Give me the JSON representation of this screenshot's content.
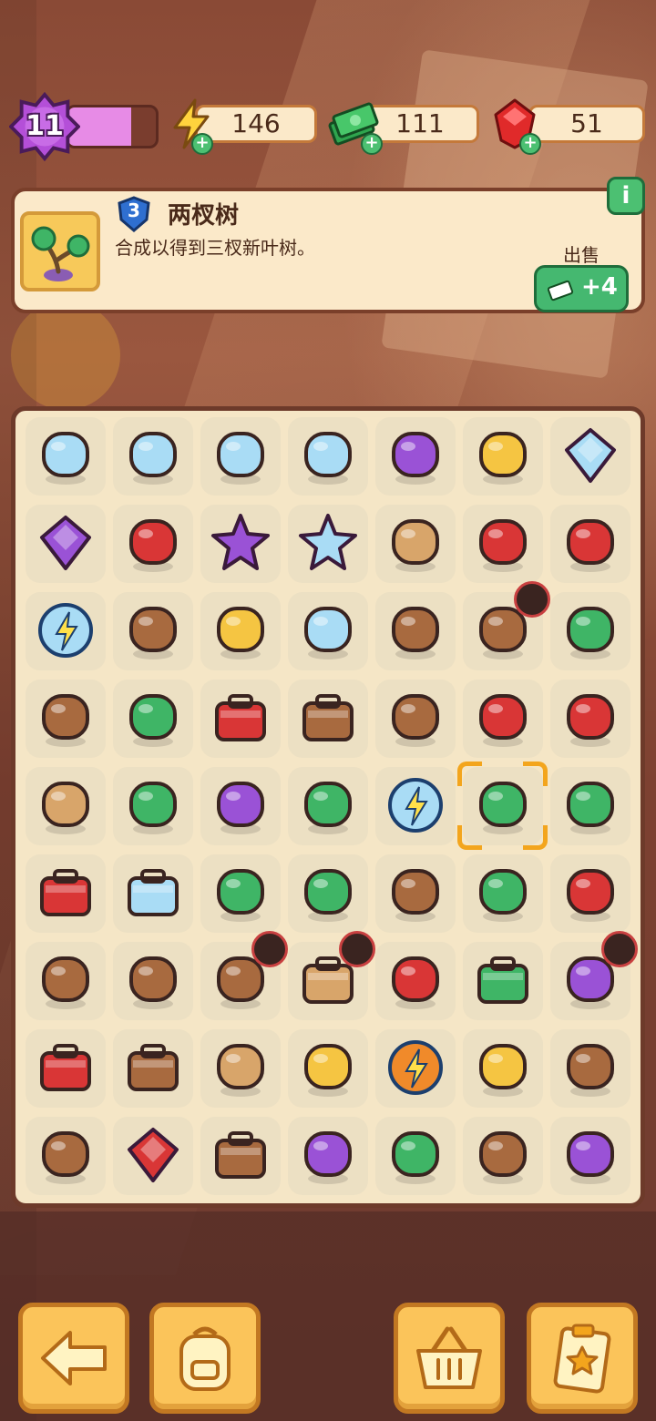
{
  "hud": {
    "level": "11",
    "level_progress": 0.72,
    "energy": "146",
    "cash": "111",
    "gems": "51"
  },
  "info": {
    "item_level": "3",
    "item_name": "两杈树",
    "item_desc": "合成以得到三杈新叶树。",
    "info_icon": "i",
    "sell_label": "出售",
    "sell_value": "+4"
  },
  "board": {
    "rows": 9,
    "cols": 7,
    "items": [
      [
        "magnifier-blue",
        "trophy-glass",
        "shield-trophy",
        "light-bulb",
        "lamp-purple",
        "magnifier-gold",
        "blue-gem"
      ],
      [
        "purple-diamond",
        "red-glove",
        "purple-star",
        "star-trophy",
        "lamp-double",
        "red-shears",
        "pruning-shears"
      ],
      [
        "energy-orb-blue",
        "cookie-piece",
        "yellow-glasses",
        "crystal-ball",
        "clay-pot",
        "photo-frame",
        "cash-stack"
      ],
      [
        "potted-plant",
        "seed-sack",
        "red-toolbox",
        "photo-bag",
        "puzzle-pieces",
        "garden-trowel",
        "garden-fork"
      ],
      [
        "caution-barrier",
        "green-vacuum",
        "purple-moth",
        "green-brush",
        "energy-orb-blue",
        "two-branch-tree",
        "leaf-sprout"
      ],
      [
        "red-tray",
        "blue-box",
        "small-sprout",
        "cash-bundle",
        "flower-pot",
        "cash-pile",
        "red-broom"
      ],
      [
        "cardboard-house",
        "stump-tools",
        "plant-pot-locked",
        "safe-locked",
        "red-machine",
        "cash-bill",
        "purple-car-locked"
      ],
      [
        "red-toolbox-small",
        "treasure-chest",
        "bike-wheels",
        "yellow-ring",
        "energy-orb-orange",
        "yellow-cap",
        "drum-log"
      ],
      [
        "beige-cubes",
        "red-ruby",
        "wooden-crate",
        "purple-bicycle",
        "bonsai-tree",
        "broken-pot",
        "purple-scooter"
      ]
    ],
    "locked": [
      "2,5",
      "6,2",
      "6,3",
      "6,6"
    ],
    "selected": "4,5"
  },
  "bottom": [
    "back-arrow-icon",
    "backpack-icon",
    "basket-icon",
    "clipboard-star-icon"
  ],
  "colors": {
    "accent": "#f3a51d",
    "panel": "#fbe9c9",
    "board": "#f5e6c6",
    "cell": "#ece0c3",
    "button": "#fbc45a",
    "green": "#45b870"
  }
}
